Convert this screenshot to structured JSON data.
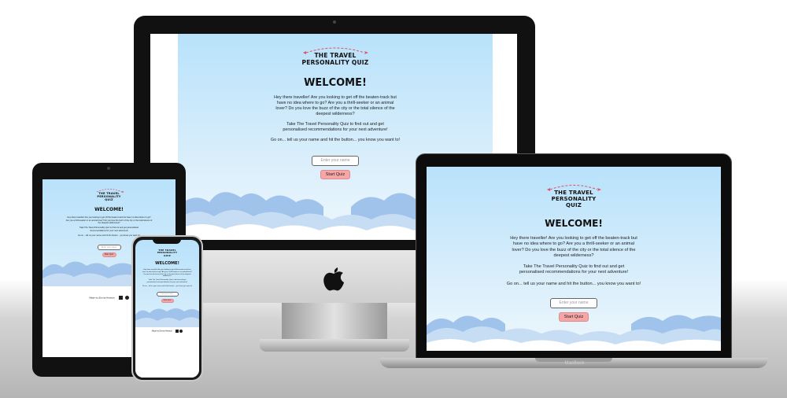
{
  "quiz": {
    "logo_line1": "THE TRAVEL",
    "logo_line2": "PERSONALITY QUIZ",
    "heading": "WELCOME!",
    "intro": "Hey there traveller! Are you looking to get off the beaten-track but have no idea where to go? Are you a thrill-seeker or an animal lover? Do you love the buzz of the city or the total silence of the deepest wilderness?",
    "take_quiz": "Take The Travel Personality Quiz to find out and get personalised recommendations for your next adventure!",
    "go_on": "Go on... tell us your name and hit the button... you know you want to!",
    "name_placeholder": "Enter your name",
    "start_button": "Start Quiz",
    "footer_credit": "Made by Emma Hewson"
  },
  "devices": {
    "laptop_label": "MacBook"
  },
  "colors": {
    "sky_top": "#b8e2fb",
    "cloud_dark": "#9fc3ea",
    "cloud_light": "#ffffff",
    "button_pink": "#f6a6a6",
    "plane_pink": "#e0506a"
  }
}
